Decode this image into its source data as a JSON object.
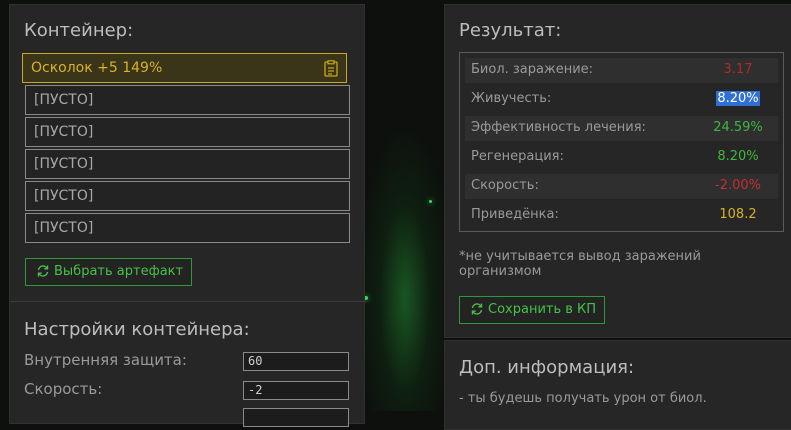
{
  "container": {
    "title": "Контейнер:",
    "slots": [
      {
        "label": "Осколок +5 149%",
        "icon": "clipboard-icon"
      },
      {
        "label": "[ПУСТО]"
      },
      {
        "label": "[ПУСТО]"
      },
      {
        "label": "[ПУСТО]"
      },
      {
        "label": "[ПУСТО]"
      },
      {
        "label": "[ПУСТО]"
      }
    ],
    "select_button": {
      "label": "Выбрать артефакт",
      "icon": "refresh-icon"
    }
  },
  "settings": {
    "title": "Настройки контейнера:",
    "fields": [
      {
        "label": "Внутренняя защита:",
        "value": "60"
      },
      {
        "label": "Скорость:",
        "value": "-2"
      }
    ]
  },
  "result": {
    "title": "Результат:",
    "rows": [
      {
        "label": "Биол. заражение:",
        "value": "3.17",
        "color": "#b02a2a"
      },
      {
        "label": "Живучесть:",
        "value": "8.20%",
        "color": "#ffffff",
        "highlight": "#2f6fd6"
      },
      {
        "label": "Эффективность лечения:",
        "value": "24.59%",
        "color": "#3fb63f"
      },
      {
        "label": "Регенерация:",
        "value": "8.20%",
        "color": "#3fb63f"
      },
      {
        "label": "Скорость:",
        "value": "-2.00%",
        "color": "#c23030"
      },
      {
        "label": "Приведёнка:",
        "value": "108.2",
        "color": "#d6b22a"
      }
    ],
    "note": "*не учитывается вывод заражений организмом",
    "save_button": {
      "label": "Сохранить в КП",
      "icon": "refresh-icon"
    }
  },
  "extra": {
    "title": "Доп. информация:",
    "text": "- ты будешь получать урон от биол."
  }
}
